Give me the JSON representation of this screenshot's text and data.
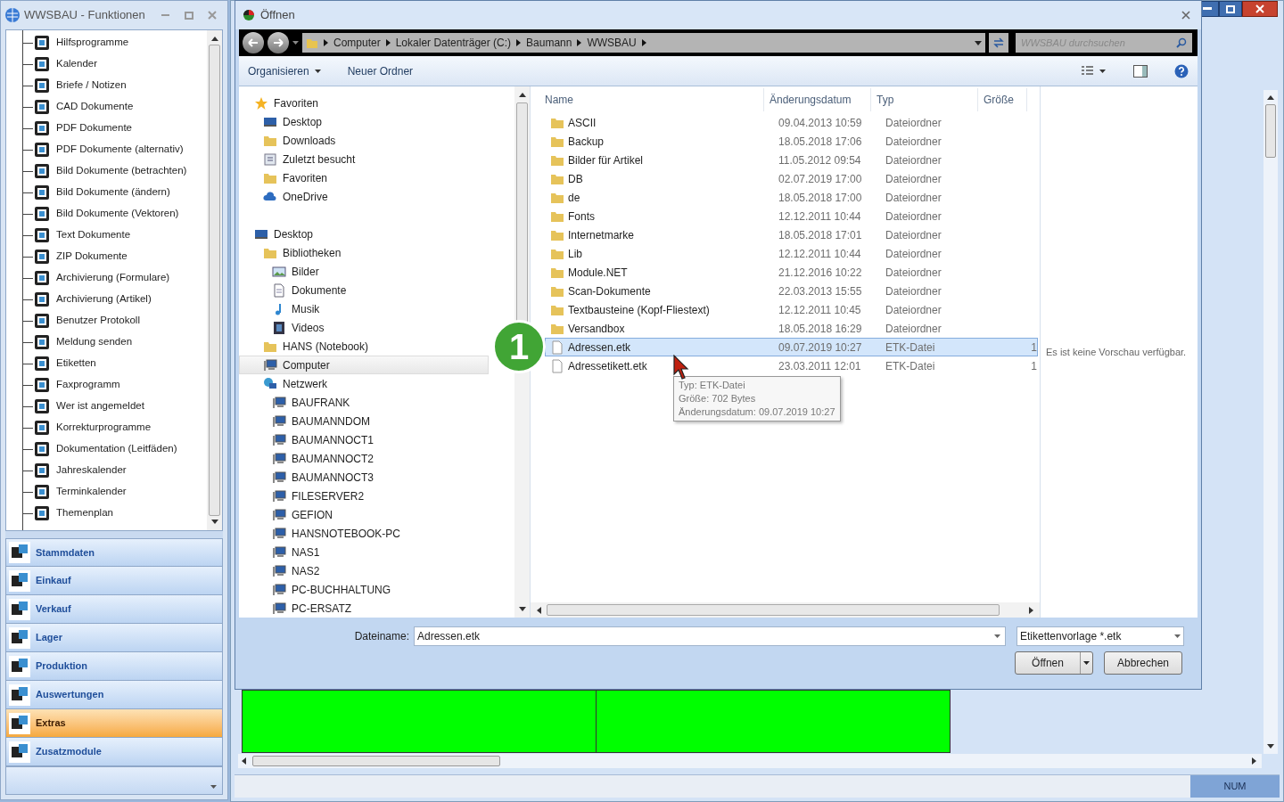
{
  "left_window": {
    "title": "WWSBAU - Funktionen",
    "tree_items": [
      {
        "label": "Hilfsprogramme"
      },
      {
        "label": "Kalender"
      },
      {
        "label": "Briefe / Notizen"
      },
      {
        "label": "CAD Dokumente"
      },
      {
        "label": "PDF Dokumente"
      },
      {
        "label": "PDF Dokumente (alternativ)"
      },
      {
        "label": "Bild Dokumente (betrachten)"
      },
      {
        "label": "Bild Dokumente (ändern)"
      },
      {
        "label": "Bild Dokumente (Vektoren)"
      },
      {
        "label": "Text Dokumente"
      },
      {
        "label": "ZIP Dokumente"
      },
      {
        "label": "Archivierung (Formulare)"
      },
      {
        "label": "Archivierung (Artikel)"
      },
      {
        "label": "Benutzer Protokoll"
      },
      {
        "label": "Meldung senden"
      },
      {
        "label": "Etiketten"
      },
      {
        "label": "Faxprogramm"
      },
      {
        "label": "Wer ist angemeldet"
      },
      {
        "label": "Korrekturprogramme"
      },
      {
        "label": "Dokumentation (Leitfäden)"
      },
      {
        "label": "Jahreskalender"
      },
      {
        "label": "Terminkalender"
      },
      {
        "label": "Themenplan"
      }
    ],
    "nav_items": [
      {
        "label": "Stammdaten",
        "selected": false
      },
      {
        "label": "Einkauf",
        "selected": false
      },
      {
        "label": "Verkauf",
        "selected": false
      },
      {
        "label": "Lager",
        "selected": false
      },
      {
        "label": "Produktion",
        "selected": false
      },
      {
        "label": "Auswertungen",
        "selected": false
      },
      {
        "label": "Extras",
        "selected": true
      },
      {
        "label": "Zusatzmodule",
        "selected": false
      }
    ]
  },
  "main_window": {
    "status_bar": {
      "indicator": "NUM"
    }
  },
  "dialog": {
    "title": "Öffnen",
    "breadcrumb": [
      "Computer",
      "Lokaler Datenträger (C:)",
      "Baumann",
      "WWSBAU"
    ],
    "search": {
      "placeholder": "WWSBAU durchsuchen"
    },
    "toolbar": [
      {
        "label": "Organisieren",
        "kind": "menu"
      },
      {
        "label": "Neuer Ordner",
        "kind": "plain"
      }
    ],
    "nav_tree": [
      {
        "label": "Favoriten",
        "kind": "star",
        "selected": false,
        "children": [
          {
            "label": "Desktop",
            "kind": "desktop",
            "selected": false
          },
          {
            "label": "Downloads",
            "kind": "folder",
            "selected": false
          },
          {
            "label": "Zuletzt besucht",
            "kind": "recent",
            "selected": false
          },
          {
            "label": "Favoriten",
            "kind": "folder",
            "selected": false
          },
          {
            "label": "OneDrive",
            "kind": "cloud",
            "selected": false
          }
        ]
      },
      {
        "label": "Desktop",
        "kind": "desktop",
        "selected": false,
        "children": [
          {
            "label": "Bibliotheken",
            "kind": "folder",
            "selected": false,
            "children": [
              {
                "label": "Bilder",
                "kind": "image",
                "selected": false
              },
              {
                "label": "Dokumente",
                "kind": "doc",
                "selected": false
              },
              {
                "label": "Musik",
                "kind": "music",
                "selected": false
              },
              {
                "label": "Videos",
                "kind": "video",
                "selected": false
              }
            ]
          },
          {
            "label": "HANS (Notebook)",
            "kind": "folder",
            "selected": false
          },
          {
            "label": "Computer",
            "kind": "computer",
            "selected": true
          },
          {
            "label": "Netzwerk",
            "kind": "network",
            "selected": false,
            "children": [
              {
                "label": "BAUFRANK",
                "kind": "computer",
                "selected": false
              },
              {
                "label": "BAUMANNDOM",
                "kind": "computer",
                "selected": false
              },
              {
                "label": "BAUMANNOCT1",
                "kind": "computer",
                "selected": false
              },
              {
                "label": "BAUMANNOCT2",
                "kind": "computer",
                "selected": false
              },
              {
                "label": "BAUMANNOCT3",
                "kind": "computer",
                "selected": false
              },
              {
                "label": "FILESERVER2",
                "kind": "computer",
                "selected": false
              },
              {
                "label": "GEFION",
                "kind": "computer",
                "selected": false
              },
              {
                "label": "HANSNOTEBOOK-PC",
                "kind": "computer",
                "selected": false
              },
              {
                "label": "NAS1",
                "kind": "computer",
                "selected": false
              },
              {
                "label": "NAS2",
                "kind": "computer",
                "selected": false
              },
              {
                "label": "PC-BUCHHALTUNG",
                "kind": "computer",
                "selected": false
              },
              {
                "label": "PC-ERSATZ",
                "kind": "computer",
                "selected": false
              }
            ]
          }
        ]
      }
    ],
    "columns": [
      "Name",
      "Änderungsdatum",
      "Typ",
      "Größe"
    ],
    "files": [
      {
        "name": "ASCII",
        "date": "09.04.2013 10:59",
        "type": "Dateiordner",
        "kind": "folder",
        "selected": false
      },
      {
        "name": "Backup",
        "date": "18.05.2018 17:06",
        "type": "Dateiordner",
        "kind": "folder",
        "selected": false
      },
      {
        "name": "Bilder für Artikel",
        "date": "11.05.2012 09:54",
        "type": "Dateiordner",
        "kind": "folder",
        "selected": false
      },
      {
        "name": "DB",
        "date": "02.07.2019 17:00",
        "type": "Dateiordner",
        "kind": "folder",
        "selected": false
      },
      {
        "name": "de",
        "date": "18.05.2018 17:00",
        "type": "Dateiordner",
        "kind": "folder",
        "selected": false
      },
      {
        "name": "Fonts",
        "date": "12.12.2011 10:44",
        "type": "Dateiordner",
        "kind": "folder",
        "selected": false
      },
      {
        "name": "Internetmarke",
        "date": "18.05.2018 17:01",
        "type": "Dateiordner",
        "kind": "folder",
        "selected": false
      },
      {
        "name": "Lib",
        "date": "12.12.2011 10:44",
        "type": "Dateiordner",
        "kind": "folder",
        "selected": false
      },
      {
        "name": "Module.NET",
        "date": "21.12.2016 10:22",
        "type": "Dateiordner",
        "kind": "folder",
        "selected": false
      },
      {
        "name": "Scan-Dokumente",
        "date": "22.03.2013 15:55",
        "type": "Dateiordner",
        "kind": "folder",
        "selected": false
      },
      {
        "name": "Textbausteine (Kopf-Fliestext)",
        "date": "12.12.2011 10:45",
        "type": "Dateiordner",
        "kind": "folder",
        "selected": false
      },
      {
        "name": "Versandbox",
        "date": "18.05.2018 16:29",
        "type": "Dateiordner",
        "kind": "folder",
        "selected": false
      },
      {
        "name": "Adressen.etk",
        "date": "09.07.2019 10:27",
        "type": "ETK-Datei",
        "size": "1",
        "kind": "file",
        "selected": true
      },
      {
        "name": "Adressetikett.etk",
        "date": "23.03.2011 12:01",
        "type": "ETK-Datei",
        "size": "1",
        "kind": "file",
        "selected": false
      }
    ],
    "preview_text": "Es ist keine Vorschau verfügbar.",
    "tooltip": [
      "Typ: ETK-Datei",
      "Größe: 702 Bytes",
      "Änderungsdatum: 09.07.2019 10:27"
    ],
    "filename": {
      "label": "Dateiname:",
      "value": "Adressen.etk"
    },
    "filter": "Etikettenvorlage *.etk",
    "buttons": [
      {
        "label": "Öffnen",
        "kind": "split"
      },
      {
        "label": "Abbrechen",
        "kind": "plain"
      }
    ]
  },
  "step_badge": "1"
}
